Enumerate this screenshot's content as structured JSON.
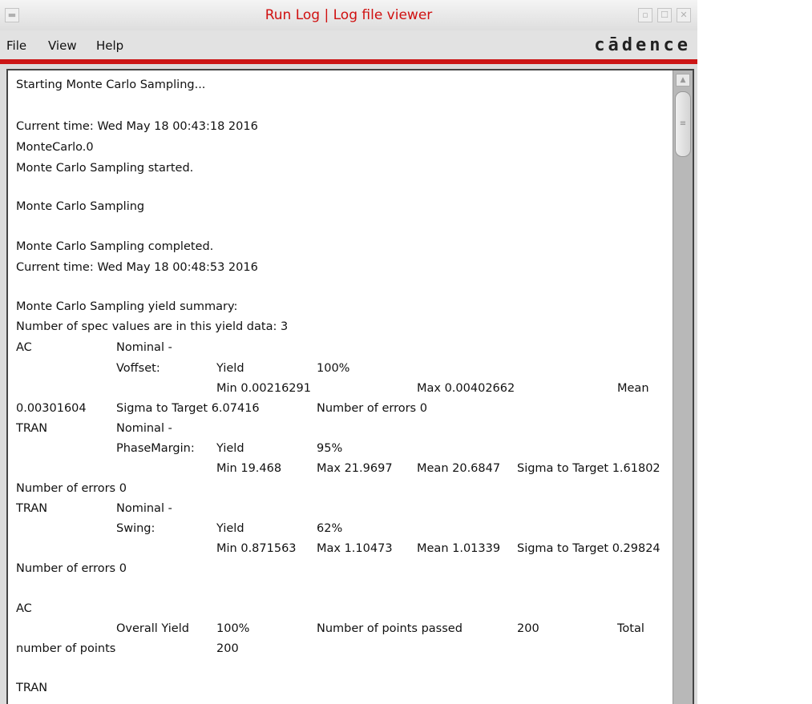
{
  "window": {
    "title": "Run Log | Log file viewer",
    "title_color": "#d01010",
    "accent_color": "#cc1515"
  },
  "menu": {
    "file": "File",
    "view": "View",
    "help": "Help",
    "brand": "cādence"
  },
  "log": {
    "l1": "Starting Monte Carlo Sampling...",
    "l2": "Current time: Wed May 18 00:43:18 2016",
    "l3": "MonteCarlo.0",
    "l4": "Monte Carlo Sampling started.",
    "l5": "Monte Carlo Sampling",
    "l6": "Monte Carlo Sampling completed.",
    "l7": "Current time: Wed May 18 00:48:53 2016",
    "l8": "Monte Carlo Sampling yield summary:",
    "l9": "Number of spec values are in this yield data: 3",
    "rows": {
      "ac1_a": "AC",
      "ac1_b": "Nominal -",
      "voff_a": "Voffset:",
      "voff_b": "Yield",
      "voff_c": "100%",
      "voff_min": "Min 0.00216291",
      "voff_max": "Max 0.00402662",
      "voff_mean": "Mean",
      "voff2_a": "0.00301604",
      "voff2_b": "Sigma to Target 6.07416",
      "voff2_c": "Number of errors 0",
      "tran1_a": "TRAN",
      "tran1_b": "Nominal -",
      "pm_a": "PhaseMargin:",
      "pm_b": "Yield",
      "pm_c": "95%",
      "pm_min": "Min 19.468",
      "pm_max": "Max 21.9697",
      "pm_mean": "Mean 20.6847",
      "pm_sig": "Sigma to Target 1.61802",
      "pm_err": "Number of errors 0",
      "tran2_a": "TRAN",
      "tran2_b": "Nominal -",
      "sw_a": "Swing:",
      "sw_b": "Yield",
      "sw_c": "62%",
      "sw_min": "Min 0.871563",
      "sw_max": "Max 1.10473",
      "sw_mean": "Mean 1.01339",
      "sw_sig": "Sigma to Target 0.29824",
      "sw_err": "Number of errors 0",
      "ac2": "AC",
      "oy_a": "Overall Yield",
      "oy_b": "100%",
      "oy_c": "Number of points passed",
      "oy_d": "200",
      "oy_e": "Total",
      "oy2_a": "number of points",
      "oy2_b": "200",
      "tran3": "TRAN"
    }
  }
}
